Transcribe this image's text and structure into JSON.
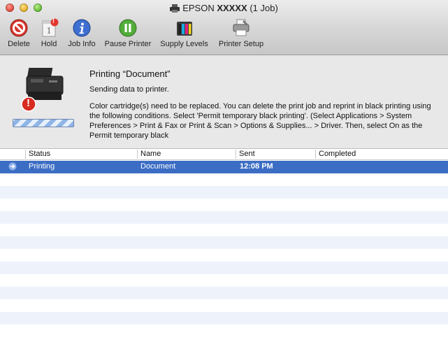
{
  "window": {
    "title_brand": "EPSON",
    "title_model": "XXXXX",
    "title_jobs": "(1 Job)"
  },
  "toolbar": {
    "items": [
      {
        "label": "Delete",
        "icon": "delete-icon"
      },
      {
        "label": "Hold",
        "icon": "hold-icon",
        "badge": "!"
      },
      {
        "label": "Job Info",
        "icon": "info-icon"
      },
      {
        "label": "Pause Printer",
        "icon": "pause-icon"
      },
      {
        "label": "Supply Levels",
        "icon": "supply-levels-icon"
      },
      {
        "label": "Printer Setup",
        "icon": "printer-setup-icon"
      }
    ]
  },
  "status": {
    "title": "Printing “Document”",
    "subtitle": "Sending data to printer.",
    "message": "Color cartridge(s) need to be replaced. You can delete the print job and reprint in black printing using the following conditions. Select 'Permit temporary black printing'. (Select Applications > System Preferences > Print & Fax or Print & Scan > Options & Supplies... > Driver. Then, select On as the Permit temporary black",
    "alert_glyph": "!"
  },
  "table": {
    "columns": [
      "Status",
      "Name",
      "Sent",
      "Completed"
    ],
    "rows": [
      {
        "status": "Printing",
        "name": "Document",
        "sent": "12:08 PM",
        "completed": ""
      }
    ]
  },
  "colors": {
    "selection": "#3b6dc4",
    "stripe": "#eef3fb"
  }
}
